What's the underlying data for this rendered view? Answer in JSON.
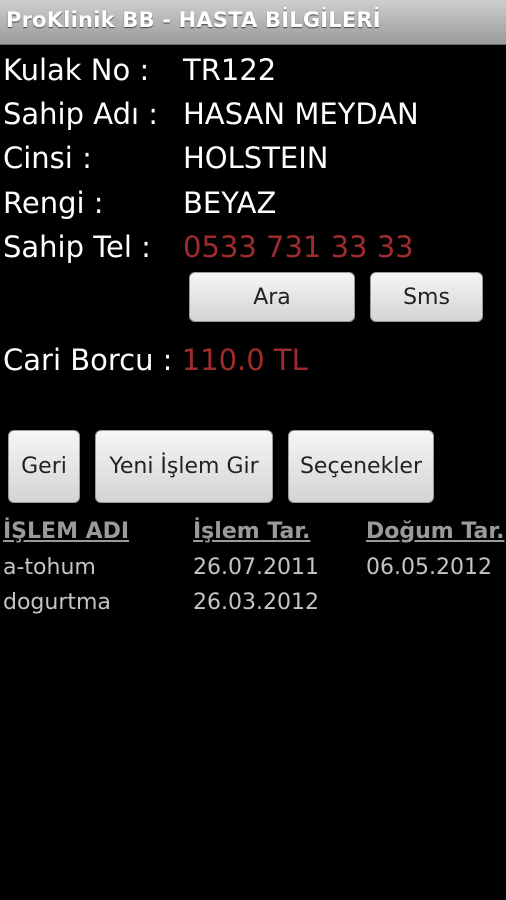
{
  "app": {
    "title": "ProKlinik BB - HASTA BİLGİLERİ"
  },
  "patient": {
    "ear_no_label": "Kulak No :",
    "ear_no": "TR122",
    "owner_label": "Sahip Adı :",
    "owner": "HASAN MEYDAN",
    "breed_label": "Cinsi :",
    "breed": "HOLSTEIN",
    "color_label": "Rengi :",
    "color": "BEYAZ",
    "phone_label": "Sahip Tel :",
    "phone": "0533 731 33 33"
  },
  "contact_buttons": {
    "call": "Ara",
    "sms": "Sms"
  },
  "debt": {
    "label": "Cari Borcu :",
    "value": "110.0 TL"
  },
  "actions": {
    "back": "Geri",
    "new_procedure": "Yeni İşlem Gir",
    "options": "Seçenekler"
  },
  "table": {
    "headers": [
      "İŞLEM ADI",
      "İşlem Tar.",
      "Doğum Tar."
    ],
    "rows": [
      [
        "a-tohum",
        "26.07.2011",
        "06.05.2012"
      ],
      [
        "dogurtma",
        "26.03.2012",
        ""
      ]
    ]
  },
  "colors": {
    "background": "#000000",
    "accent_red": "#9e2b30",
    "header_gray": "#9a9a9a"
  }
}
